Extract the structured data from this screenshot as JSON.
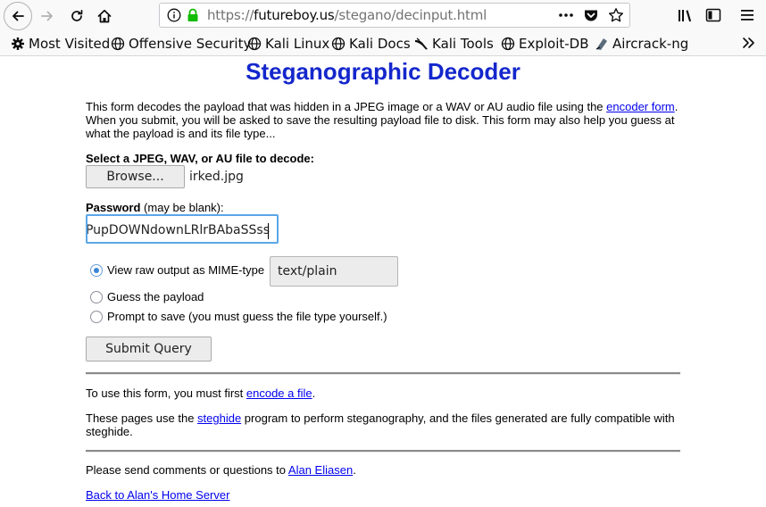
{
  "browser": {
    "url": {
      "scheme": "https://",
      "domain": "futureboy.us",
      "path": "/stegano/decinput.html"
    },
    "bookmarks": [
      {
        "label": "Most Visited",
        "icon": "gear-icon"
      },
      {
        "label": "Offensive Security",
        "icon": "globe-icon"
      },
      {
        "label": "Kali Linux",
        "icon": "globe-icon"
      },
      {
        "label": "Kali Docs",
        "icon": "globe-icon"
      },
      {
        "label": "Kali Tools",
        "icon": "kali-dragon-icon"
      },
      {
        "label": "Exploit-DB",
        "icon": "globe-icon"
      },
      {
        "label": "Aircrack-ng",
        "icon": "aircrack-icon"
      }
    ]
  },
  "page": {
    "title": "Steganographic Decoder",
    "intro": {
      "text_before": "This form decodes the payload that was hidden in a JPEG image or a WAV or AU audio file using the ",
      "link": "encoder form",
      "text_after": ". When you submit, you will be asked to save the resulting payload file to disk. This form may also help you guess at what the payload is and its file type..."
    },
    "file_label": "Select a JPEG, WAV, or AU file to decode:",
    "browse_button": "Browse...",
    "file_name": "irked.jpg",
    "password_label": "Password",
    "password_hint": " (may be blank):",
    "password_value": "UPupDOWNdownLRlrBAbaSSss",
    "options": [
      {
        "label": "View raw output as MIME-type",
        "checked": true
      },
      {
        "label": "Guess the payload",
        "checked": false
      },
      {
        "label": "Prompt to save (you must guess the file type yourself.)",
        "checked": false
      }
    ],
    "mime_type": "text/plain",
    "submit_button": "Submit Query",
    "usage": {
      "text_before": "To use this form, you must first ",
      "link": "encode a file",
      "text_after": "."
    },
    "tool_note": {
      "text_before": "These pages use the ",
      "link": "steghide",
      "text_after": " program to perform steganography, and the files generated are fully compatible with steghide."
    },
    "contact": {
      "text_before": "Please send comments or questions to ",
      "link": "Alan Eliasen",
      "text_after": "."
    },
    "home_link": "Back to Alan's Home Server"
  },
  "colors": {
    "title": "#1427cc",
    "link": "#0000ee",
    "focus_ring": "#5aa7e8"
  }
}
